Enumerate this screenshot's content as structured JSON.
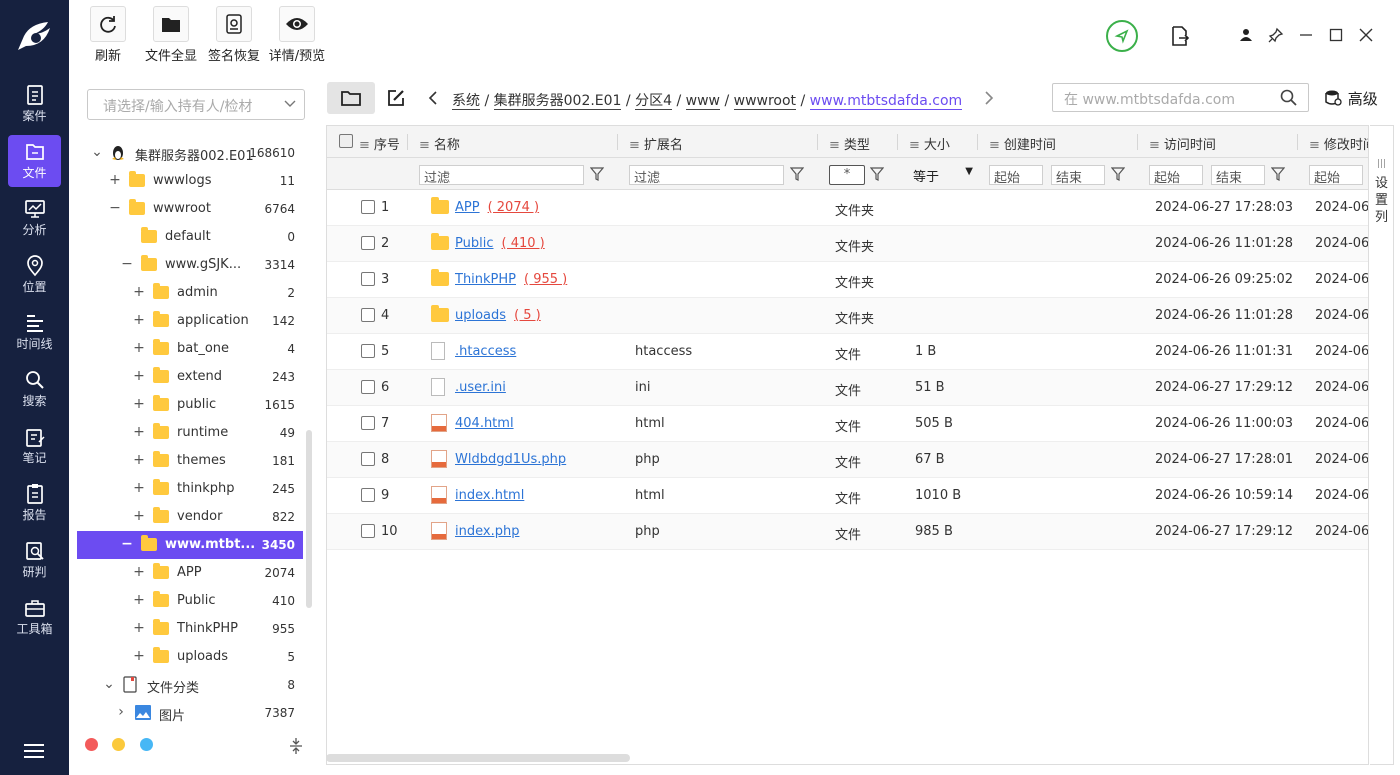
{
  "nav": {
    "items": [
      {
        "label": "案件",
        "icon": "case-icon"
      },
      {
        "label": "文件",
        "icon": "file-icon"
      },
      {
        "label": "分析",
        "icon": "analysis-icon"
      },
      {
        "label": "位置",
        "icon": "location-icon"
      },
      {
        "label": "时间线",
        "icon": "timeline-icon"
      },
      {
        "label": "搜索",
        "icon": "search-icon"
      },
      {
        "label": "笔记",
        "icon": "note-icon"
      },
      {
        "label": "报告",
        "icon": "report-icon"
      },
      {
        "label": "研判",
        "icon": "research-icon"
      },
      {
        "label": "工具箱",
        "icon": "toolbox-icon"
      }
    ],
    "active_index": 1,
    "accent": "#6c4cf1",
    "background": "#16213f"
  },
  "toolbar": {
    "refresh": "刷新",
    "show_all_files": "文件全显",
    "signature_restore": "签名恢复",
    "details_preview": "详情/预览"
  },
  "left": {
    "owner_select_placeholder": "请选择/输入持有人/检材",
    "tree": [
      {
        "label": "集群服务器002.E01",
        "count": "168610",
        "toggle": "⌄"
      },
      {
        "label": "wwwlogs",
        "count": "11",
        "toggle": "+"
      },
      {
        "label": "wwwroot",
        "count": "6764",
        "toggle": "−"
      },
      {
        "label": "default",
        "count": "0",
        "toggle": ""
      },
      {
        "label": "www.gSJK...",
        "count": "3314",
        "toggle": "−"
      },
      {
        "label": "admin",
        "count": "2",
        "toggle": "+"
      },
      {
        "label": "application",
        "count": "142",
        "toggle": "+"
      },
      {
        "label": "bat_one",
        "count": "4",
        "toggle": "+"
      },
      {
        "label": "extend",
        "count": "243",
        "toggle": "+"
      },
      {
        "label": "public",
        "count": "1615",
        "toggle": "+"
      },
      {
        "label": "runtime",
        "count": "49",
        "toggle": "+"
      },
      {
        "label": "themes",
        "count": "181",
        "toggle": "+"
      },
      {
        "label": "thinkphp",
        "count": "245",
        "toggle": "+"
      },
      {
        "label": "vendor",
        "count": "822",
        "toggle": "+"
      },
      {
        "label": "www.mtbt...",
        "count": "3450",
        "toggle": "−"
      },
      {
        "label": "APP",
        "count": "2074",
        "toggle": "+"
      },
      {
        "label": "Public",
        "count": "410",
        "toggle": "+"
      },
      {
        "label": "ThinkPHP",
        "count": "955",
        "toggle": "+"
      },
      {
        "label": "uploads",
        "count": "5",
        "toggle": "+"
      },
      {
        "label": "文件分类",
        "count": "8",
        "toggle": "⌄"
      },
      {
        "label": "图片",
        "count": "7387",
        "toggle": "›"
      }
    ]
  },
  "breadcrumb": {
    "parts": [
      "系统",
      "集群服务器002.E01",
      "分区4",
      "www",
      "wwwroot"
    ],
    "current": "www.mtbtsdafda.com"
  },
  "search": {
    "placeholder": "在 www.mtbtsdafda.com",
    "advanced": "高级"
  },
  "table": {
    "headers": {
      "index": "序号",
      "name": "名称",
      "ext": "扩展名",
      "type": "类型",
      "size": "大小",
      "created": "创建时间",
      "accessed": "访问时间",
      "modified": "修改时间"
    },
    "filters": {
      "name": "过滤",
      "ext": "过滤",
      "type": "*",
      "size_op": "等于",
      "start": "起始",
      "end": "结束"
    },
    "rows": [
      {
        "no": "1",
        "name": "APP",
        "count": "( 2074 )",
        "ext": "",
        "type": "文件夹",
        "size": "",
        "accessed": "2024-06-27 17:28:03",
        "modified": "2024-06-",
        "kind": "folder"
      },
      {
        "no": "2",
        "name": "Public",
        "count": "( 410 )",
        "ext": "",
        "type": "文件夹",
        "size": "",
        "accessed": "2024-06-26 11:01:28",
        "modified": "2024-06-",
        "kind": "folder"
      },
      {
        "no": "3",
        "name": "ThinkPHP",
        "count": "( 955 )",
        "ext": "",
        "type": "文件夹",
        "size": "",
        "accessed": "2024-06-26 09:25:02",
        "modified": "2024-06-",
        "kind": "folder"
      },
      {
        "no": "4",
        "name": "uploads",
        "count": "( 5 )",
        "ext": "",
        "type": "文件夹",
        "size": "",
        "accessed": "2024-06-26 11:01:28",
        "modified": "2024-06-",
        "kind": "folder"
      },
      {
        "no": "5",
        "name": ".htaccess",
        "count": "",
        "ext": "htaccess",
        "type": "文件",
        "size": "1 B",
        "accessed": "2024-06-26 11:01:31",
        "modified": "2024-06-",
        "kind": "doc"
      },
      {
        "no": "6",
        "name": ".user.ini",
        "count": "",
        "ext": "ini",
        "type": "文件",
        "size": "51 B",
        "accessed": "2024-06-27 17:29:12",
        "modified": "2024-06-",
        "kind": "doc"
      },
      {
        "no": "7",
        "name": "404.html",
        "count": "",
        "ext": "html",
        "type": "文件",
        "size": "505 B",
        "accessed": "2024-06-26 11:00:03",
        "modified": "2024-06-",
        "kind": "html"
      },
      {
        "no": "8",
        "name": "Wldbdgd1Us.php",
        "count": "",
        "ext": "php",
        "type": "文件",
        "size": "67 B",
        "accessed": "2024-06-27 17:28:01",
        "modified": "2024-06-",
        "kind": "html"
      },
      {
        "no": "9",
        "name": "index.html",
        "count": "",
        "ext": "html",
        "type": "文件",
        "size": "1010 B",
        "accessed": "2024-06-26 10:59:14",
        "modified": "2024-06-",
        "kind": "html"
      },
      {
        "no": "10",
        "name": "index.php",
        "count": "",
        "ext": "php",
        "type": "文件",
        "size": "985 B",
        "accessed": "2024-06-27 17:29:12",
        "modified": "2024-06-",
        "kind": "html"
      }
    ],
    "set_columns": "设置列"
  }
}
